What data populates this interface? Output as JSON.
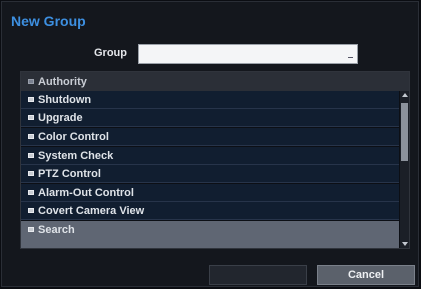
{
  "dialog": {
    "title": "New Group",
    "group_label": "Group",
    "group_value": ""
  },
  "list": {
    "header": "Authority",
    "items": [
      {
        "label": "Shutdown",
        "checked": true
      },
      {
        "label": "Upgrade",
        "checked": true
      },
      {
        "label": "Color Control",
        "checked": true
      },
      {
        "label": "System Check",
        "checked": true
      },
      {
        "label": "PTZ Control",
        "checked": true
      },
      {
        "label": "Alarm-Out Control",
        "checked": true
      },
      {
        "label": "Covert Camera View",
        "checked": true
      },
      {
        "label": "Search",
        "checked": true
      }
    ]
  },
  "buttons": {
    "ok_label": "",
    "cancel_label": "Cancel"
  },
  "colors": {
    "title": "#3d8fe0",
    "row_bg": "#111e30",
    "selected_row_bg": "#5f6673"
  }
}
